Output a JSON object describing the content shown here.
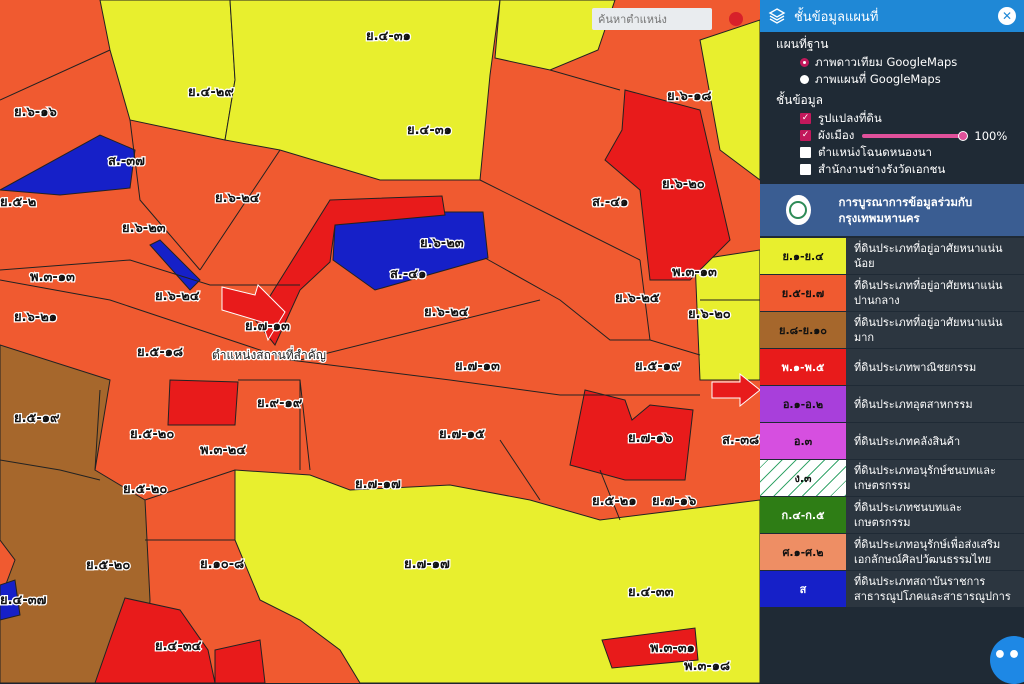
{
  "map": {
    "search_placeholder": "ค้นหาตำแหน่ง",
    "landmark_label": "ตำแหน่งสถานที่สำคัญ",
    "zone_labels": [
      "ย.๔-๓๑",
      "ย.๔-๒๙",
      "ย.๖-๑๖",
      "ย.๔-๓๑",
      "ย.๖-๑๘",
      "ส.-๓๗",
      "ย.๖-๒๓",
      "ย.๖-๒๔",
      "ย.๖-๒๓",
      "ส.-๔๑",
      "ส.-๔๑",
      "ย.๖-๒๐",
      "พ.๓-๑๓",
      "พ.๓-๑๓",
      "ย.๖-๒๔",
      "ย.๖-๒๕",
      "ย.๖-๒๐",
      "ย.๖-๒๑",
      "ย.๗-๑๓",
      "ย.๖-๒๔",
      "ย.๕-๑๘",
      "ย.๗-๑๓",
      "ย.๕-๑๙",
      "ย.๕-๑๙",
      "ย.๙-๑๙",
      "ย.๗-๑๕",
      "ย.๕-๒๐",
      "ย.๗-๑๖",
      "พ.๓-๒๔",
      "ย.๗-๑๗",
      "ย.๕-๒๐",
      "ย.๗-๑๖",
      "ย.๕-๒๑",
      "ย.๕-๒๐",
      "ย.๑๐-๘",
      "ย.๗-๑๗",
      "ย.๔-๓๓",
      "ย.๔-๓๔",
      "พ.๓-๓๑",
      "พ.๓-๑๘",
      "ย.๔-๓๗",
      "ส.-๓๘",
      "ย.๕-๒",
      "๓๗"
    ]
  },
  "panel": {
    "title": "ชั้นข้อมูลแผนที่",
    "close_icon": "✕",
    "basemap_heading": "แผนที่ฐาน",
    "basemap_options": [
      {
        "label": "ภาพดาวเทียม GoogleMaps",
        "selected": true
      },
      {
        "label": "ภาพแผนที่ GoogleMaps",
        "selected": false
      }
    ],
    "layers_heading": "ชั้นข้อมูล",
    "layers": [
      {
        "label": "รูปแปลงที่ดิน",
        "checked": true
      },
      {
        "label": "ผังเมือง",
        "checked": true,
        "opacity": "100%",
        "opacity_value": 1.0
      },
      {
        "label": "ตำแหน่งโฉนดหนองนา",
        "checked": false
      },
      {
        "label": "สำนักงานช่างรังวัดเอกชน",
        "checked": false
      }
    ],
    "partner_text": "การบูรณาการข้อมูลร่วมกับกรุงเทพมหานคร",
    "legend": [
      {
        "code": "ย.๑-ย.๔",
        "desc": "ที่ดินประเภทที่อยู่อาศัยหนาแน่นน้อย",
        "color": "#e8ef2e"
      },
      {
        "code": "ย.๕-ย.๗",
        "desc": "ที่ดินประเภทที่อยู่อาศัยหนาแน่นปานกลาง",
        "color": "#f05a30"
      },
      {
        "code": "ย.๘-ย.๑๐",
        "desc": "ที่ดินประเภทที่อยู่อาศัยหนาแน่นมาก",
        "color": "#a6672c"
      },
      {
        "code": "พ.๑-พ.๕",
        "desc": "ที่ดินประเภทพาณิชยกรรม",
        "color": "#e81b1b"
      },
      {
        "code": "อ.๑-อ.๒",
        "desc": "ที่ดินประเภทอุตสาหกรรม",
        "color": "#a83fdb"
      },
      {
        "code": "อ.๓",
        "desc": "ที่ดินประเภทคลังสินค้า",
        "color": "#d64fe0"
      },
      {
        "code": "ง.๓",
        "desc": "ที่ดินประเภทอนุรักษ์ชนบทและเกษตรกรรม",
        "color": "hatch"
      },
      {
        "code": "ก.๔-ก.๕",
        "desc": "ที่ดินประเภทชนบทและเกษตรกรรม",
        "color": "#2e7d15"
      },
      {
        "code": "ศ.๑-ศ.๒",
        "desc": "ที่ดินประเภทอนุรักษ์เพื่อส่งเสริมเอกลักษณ์ศิลปวัฒนธรรมไทย",
        "color": "#ee8e64"
      },
      {
        "code": "ส",
        "desc": "ที่ดินประเภทสถาบันราชการ สาธารณูปโภคและสาธารณูปการ",
        "color": "#1620c8"
      }
    ]
  },
  "fab_label": "•••",
  "colors": {
    "accent": "#1f88d6",
    "checkbox": "#c2185b",
    "partner_band": "#3a5d92"
  }
}
